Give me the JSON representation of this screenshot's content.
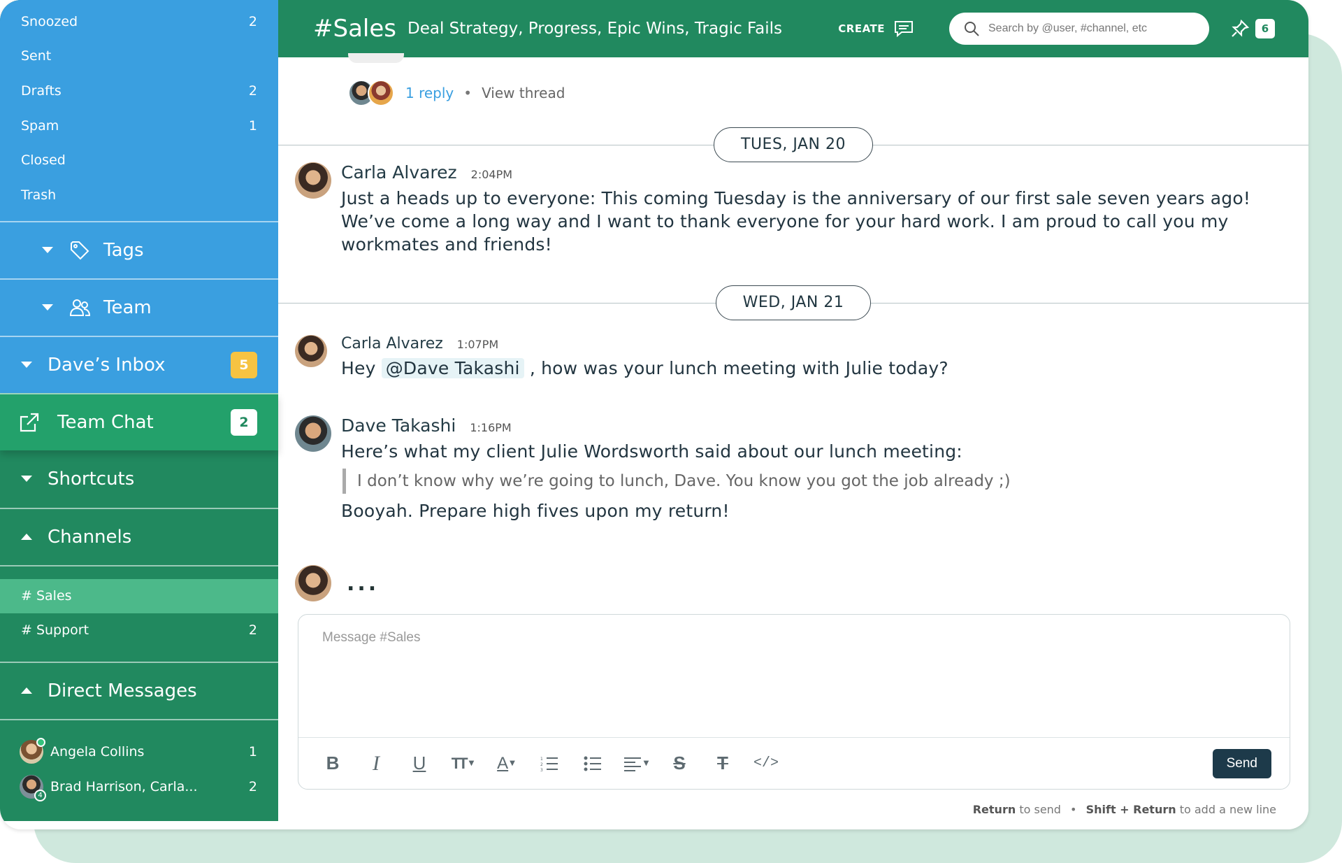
{
  "sidebar": {
    "mail_items": [
      {
        "label": "Snoozed",
        "count": "2"
      },
      {
        "label": "Sent",
        "count": ""
      },
      {
        "label": "Drafts",
        "count": "2"
      },
      {
        "label": "Spam",
        "count": "1"
      },
      {
        "label": "Closed",
        "count": ""
      },
      {
        "label": "Trash",
        "count": ""
      }
    ],
    "tags_label": "Tags",
    "team_label": "Team",
    "daves_inbox": {
      "label": "Dave’s Inbox",
      "badge": "5"
    },
    "team_chat": {
      "label": "Team Chat",
      "badge": "2"
    },
    "shortcuts_label": "Shortcuts",
    "channels_label": "Channels",
    "channels": [
      {
        "label": "# Sales",
        "count": ""
      },
      {
        "label": "# Support",
        "count": "2"
      }
    ],
    "dm_label": "Direct Messages",
    "dms": [
      {
        "label": "Angela Collins",
        "count": "1"
      },
      {
        "label": "Brad Harrison, Carla...",
        "count": "2",
        "group_size": "4"
      }
    ]
  },
  "header": {
    "channel": "#Sales",
    "topic": "Deal Strategy, Progress, Epic Wins, Tragic Fails",
    "create_label": "CREATE",
    "search_placeholder": "Search by @user, #channel, etc",
    "pins_count": "6"
  },
  "thread": {
    "reply_label": "1 reply",
    "separator": "•",
    "view_thread_label": "View thread"
  },
  "days": [
    {
      "label": "TUES, JAN 20"
    },
    {
      "label": "WED, JAN 21"
    }
  ],
  "messages": [
    {
      "author": "Carla Alvarez",
      "time": "2:04PM",
      "text": "Just a heads up to everyone: This coming Tuesday is the anniversary of our first sale seven years ago! We’ve come a long way and I want to thank everyone for your hard work. I am proud to call you my workmates and friends!"
    },
    {
      "author": "Carla Alvarez",
      "time": "1:07PM",
      "text_before": "Hey",
      "mention": "@Dave Takashi",
      "text_after": ", how was your lunch meeting with Julie today?"
    },
    {
      "author": "Dave Takashi",
      "time": "1:16PM",
      "text": "Here’s what my client Julie Wordsworth said about our lunch meeting:",
      "quote": "I don’t know why we’re going to lunch, Dave. You know you got the job already ;)",
      "text_after": "Booyah. Prepare high fives upon my return!"
    }
  ],
  "typing": {
    "dots": "..."
  },
  "composer": {
    "placeholder": "Message #Sales",
    "send_label": "Send",
    "hint_return": "Return",
    "hint_send": "to send",
    "hint_sep": "•",
    "hint_shift": "Shift + Return",
    "hint_newline": "to add a new line"
  },
  "toolbar": {
    "bold": "B",
    "italic": "I",
    "underline": "U",
    "text_size": "TT",
    "text_color": "A",
    "strike": "S",
    "clear_format": "T",
    "code": "</>"
  },
  "colors": {
    "sidebar_blue": "#3a9fe0",
    "sidebar_green": "#21895f",
    "team_chat_green": "#23a16b",
    "active_channel": "#4cb98a",
    "badge_yellow": "#f6c342",
    "send_button": "#1d3a4a",
    "link_blue": "#3a9fe0"
  }
}
